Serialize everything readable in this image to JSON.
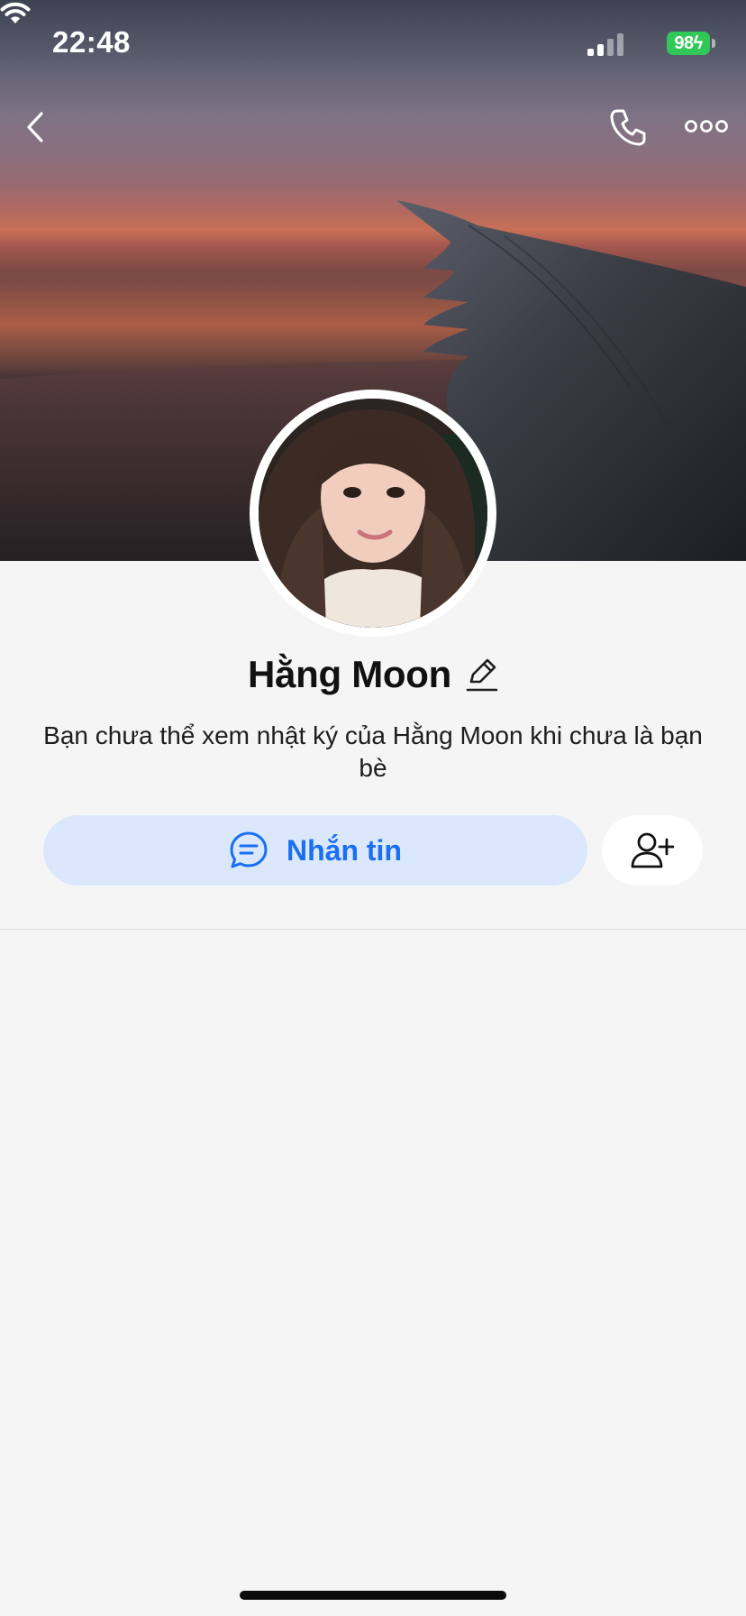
{
  "status_bar": {
    "time": "22:48",
    "battery_level": "98",
    "battery_charging": true,
    "signal_bars_active": 2,
    "icons": [
      "signal-icon",
      "wifi-icon",
      "battery-icon"
    ]
  },
  "nav": {
    "icons": [
      "back-arrow-icon",
      "phone-icon",
      "more-icon"
    ]
  },
  "profile": {
    "name": "Hằng Moon",
    "notice": "Bạn chưa thể xem nhật ký của Hằng Moon khi chưa là bạn bè"
  },
  "actions": {
    "message_label": "Nhắn tin",
    "message_icon": "chat-bubble-icon",
    "add_friend_icon": "add-friend-icon"
  },
  "colors": {
    "accent": "#1a6ff2",
    "message_button_bg": "#dbe8fb",
    "battery": "#32c759",
    "page_bg": "#f5f5f6"
  }
}
